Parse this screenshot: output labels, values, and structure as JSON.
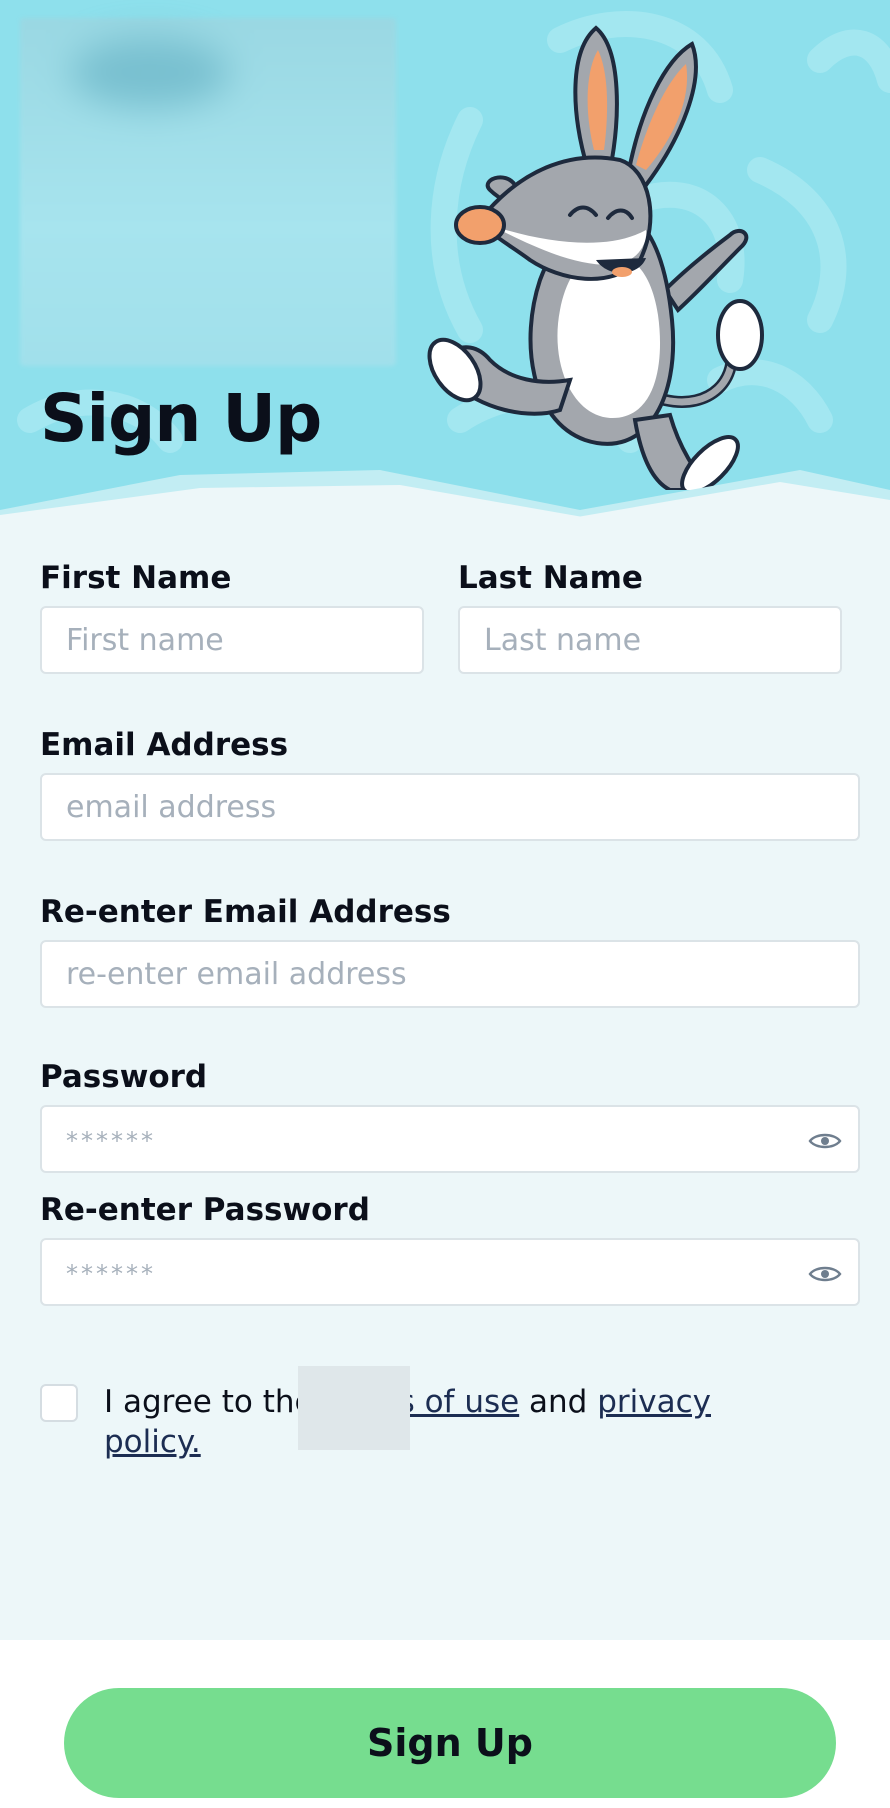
{
  "header": {
    "title": "Sign Up"
  },
  "form": {
    "first_name": {
      "label": "First Name",
      "placeholder": "First name",
      "value": ""
    },
    "last_name": {
      "label": "Last Name",
      "placeholder": "Last name",
      "value": ""
    },
    "email": {
      "label": "Email Address",
      "placeholder": "email address",
      "value": ""
    },
    "email_confirm": {
      "label": "Re-enter Email Address",
      "placeholder": "re-enter email address",
      "value": ""
    },
    "password": {
      "label": "Password",
      "placeholder": "******",
      "value": ""
    },
    "password_confirm": {
      "label": "Re-enter Password",
      "placeholder": "******",
      "value": ""
    }
  },
  "agreement": {
    "prefix": "I agree to the ",
    "terms_link": "Terms of use",
    "conjunction": " and ",
    "privacy_link": "privacy policy.",
    "checked": false
  },
  "footer": {
    "submit_label": "Sign Up"
  },
  "colors": {
    "header_bg": "#8ee0ec",
    "page_bg": "#edf7f9",
    "button_bg": "#76dd8f",
    "link": "#1c2d52"
  },
  "icons": [
    "mascot-illustration",
    "eye-icon"
  ]
}
